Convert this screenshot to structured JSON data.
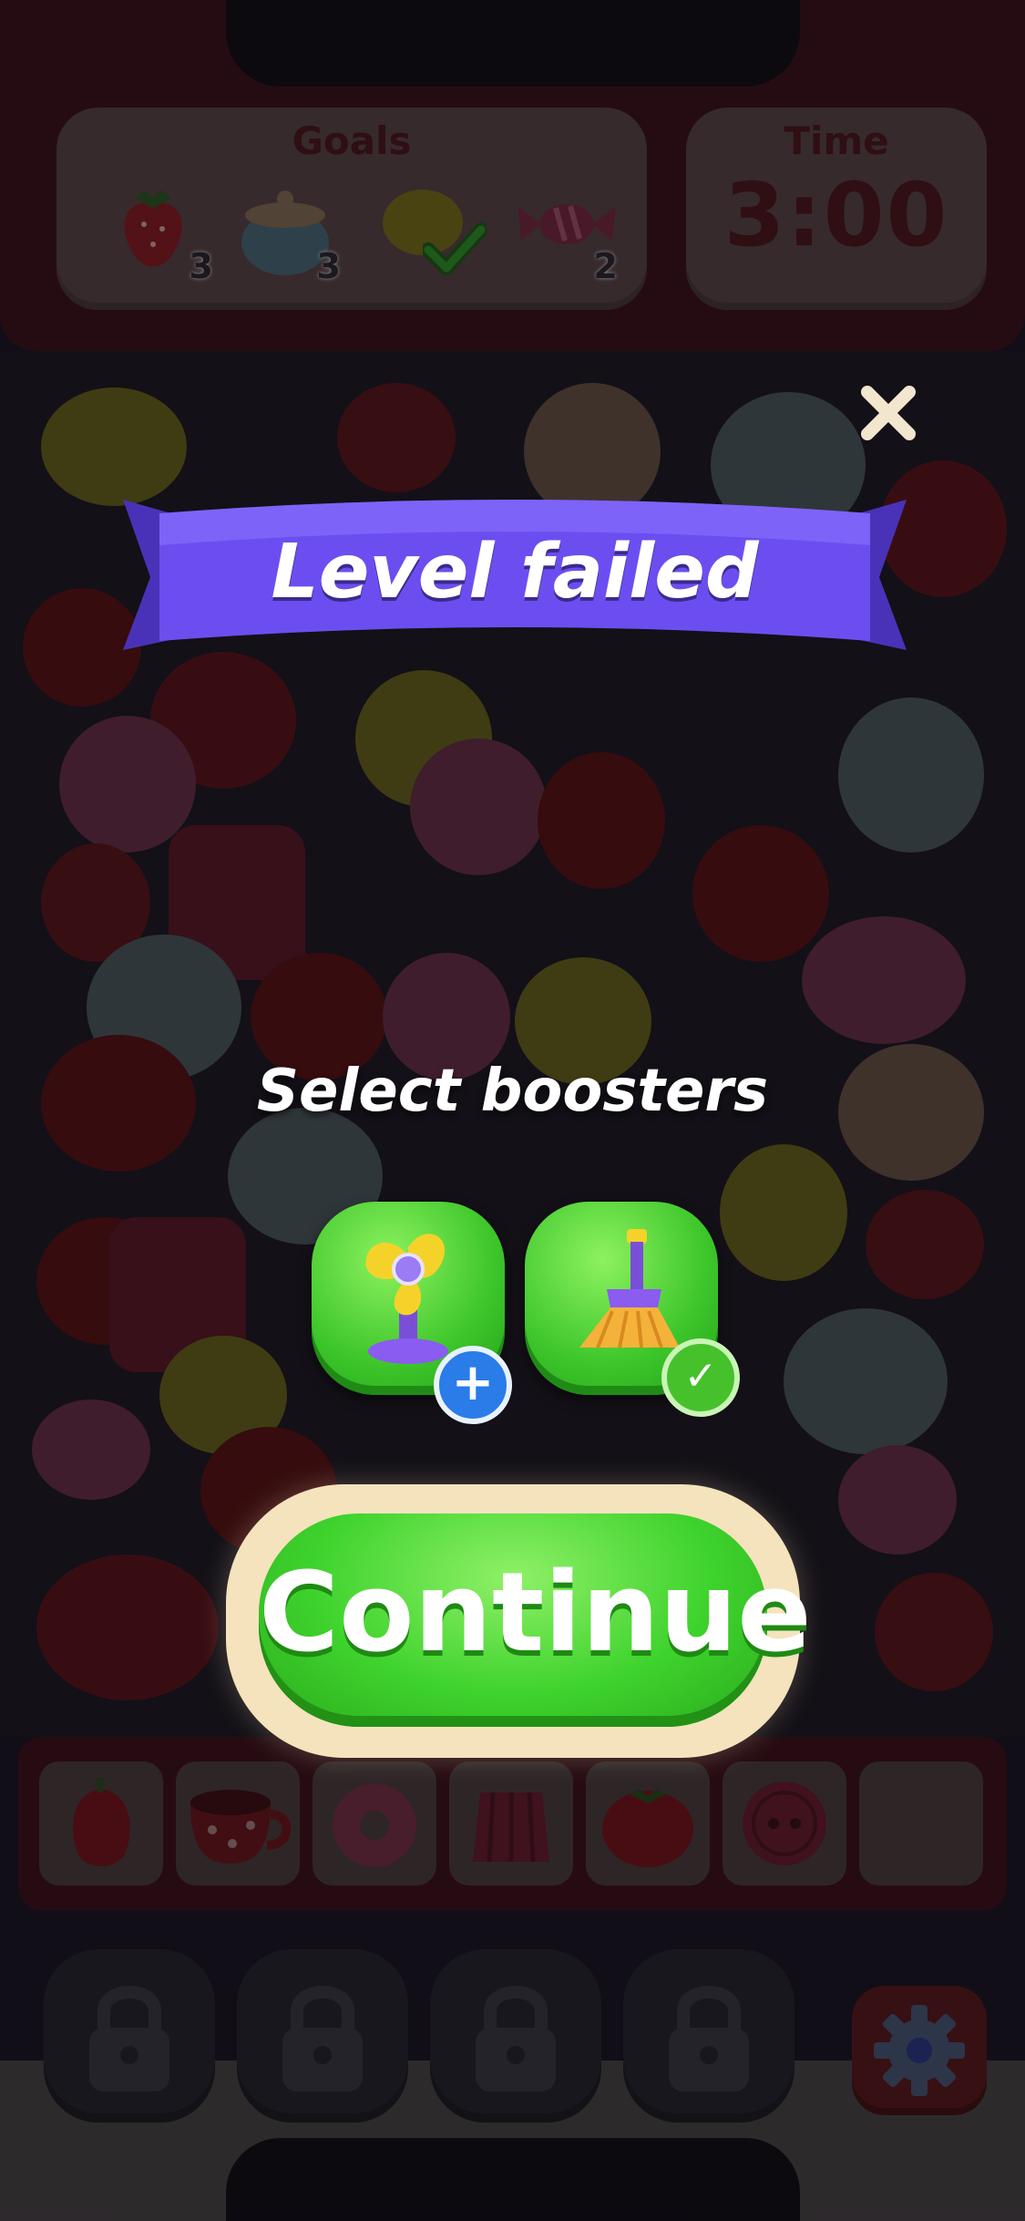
{
  "goals": {
    "title": "Goals",
    "items": [
      {
        "icon": "strawberry-icon",
        "count": "3",
        "done": false
      },
      {
        "icon": "sugar-bowl-icon",
        "count": "3",
        "done": false
      },
      {
        "icon": "lemon-icon",
        "count": "",
        "done": true
      },
      {
        "icon": "candy-icon",
        "count": "2",
        "done": false
      }
    ]
  },
  "timer": {
    "label": "Time",
    "value": "3:00"
  },
  "dialog": {
    "title": "Level failed",
    "subtitle": "Select boosters",
    "boosters": [
      {
        "icon": "fan-icon",
        "badge": "plus"
      },
      {
        "icon": "broom-icon",
        "badge": "check"
      }
    ],
    "continue_label": "Continue"
  },
  "tray": {
    "slots": [
      "pepper-icon",
      "teacup-icon",
      "donut-icon",
      "jelly-icon",
      "tomato-icon",
      "button-icon",
      ""
    ]
  },
  "colors": {
    "ribbon": "#6c4ef0",
    "continue": "#3fd32d",
    "header": "#3b1018"
  }
}
